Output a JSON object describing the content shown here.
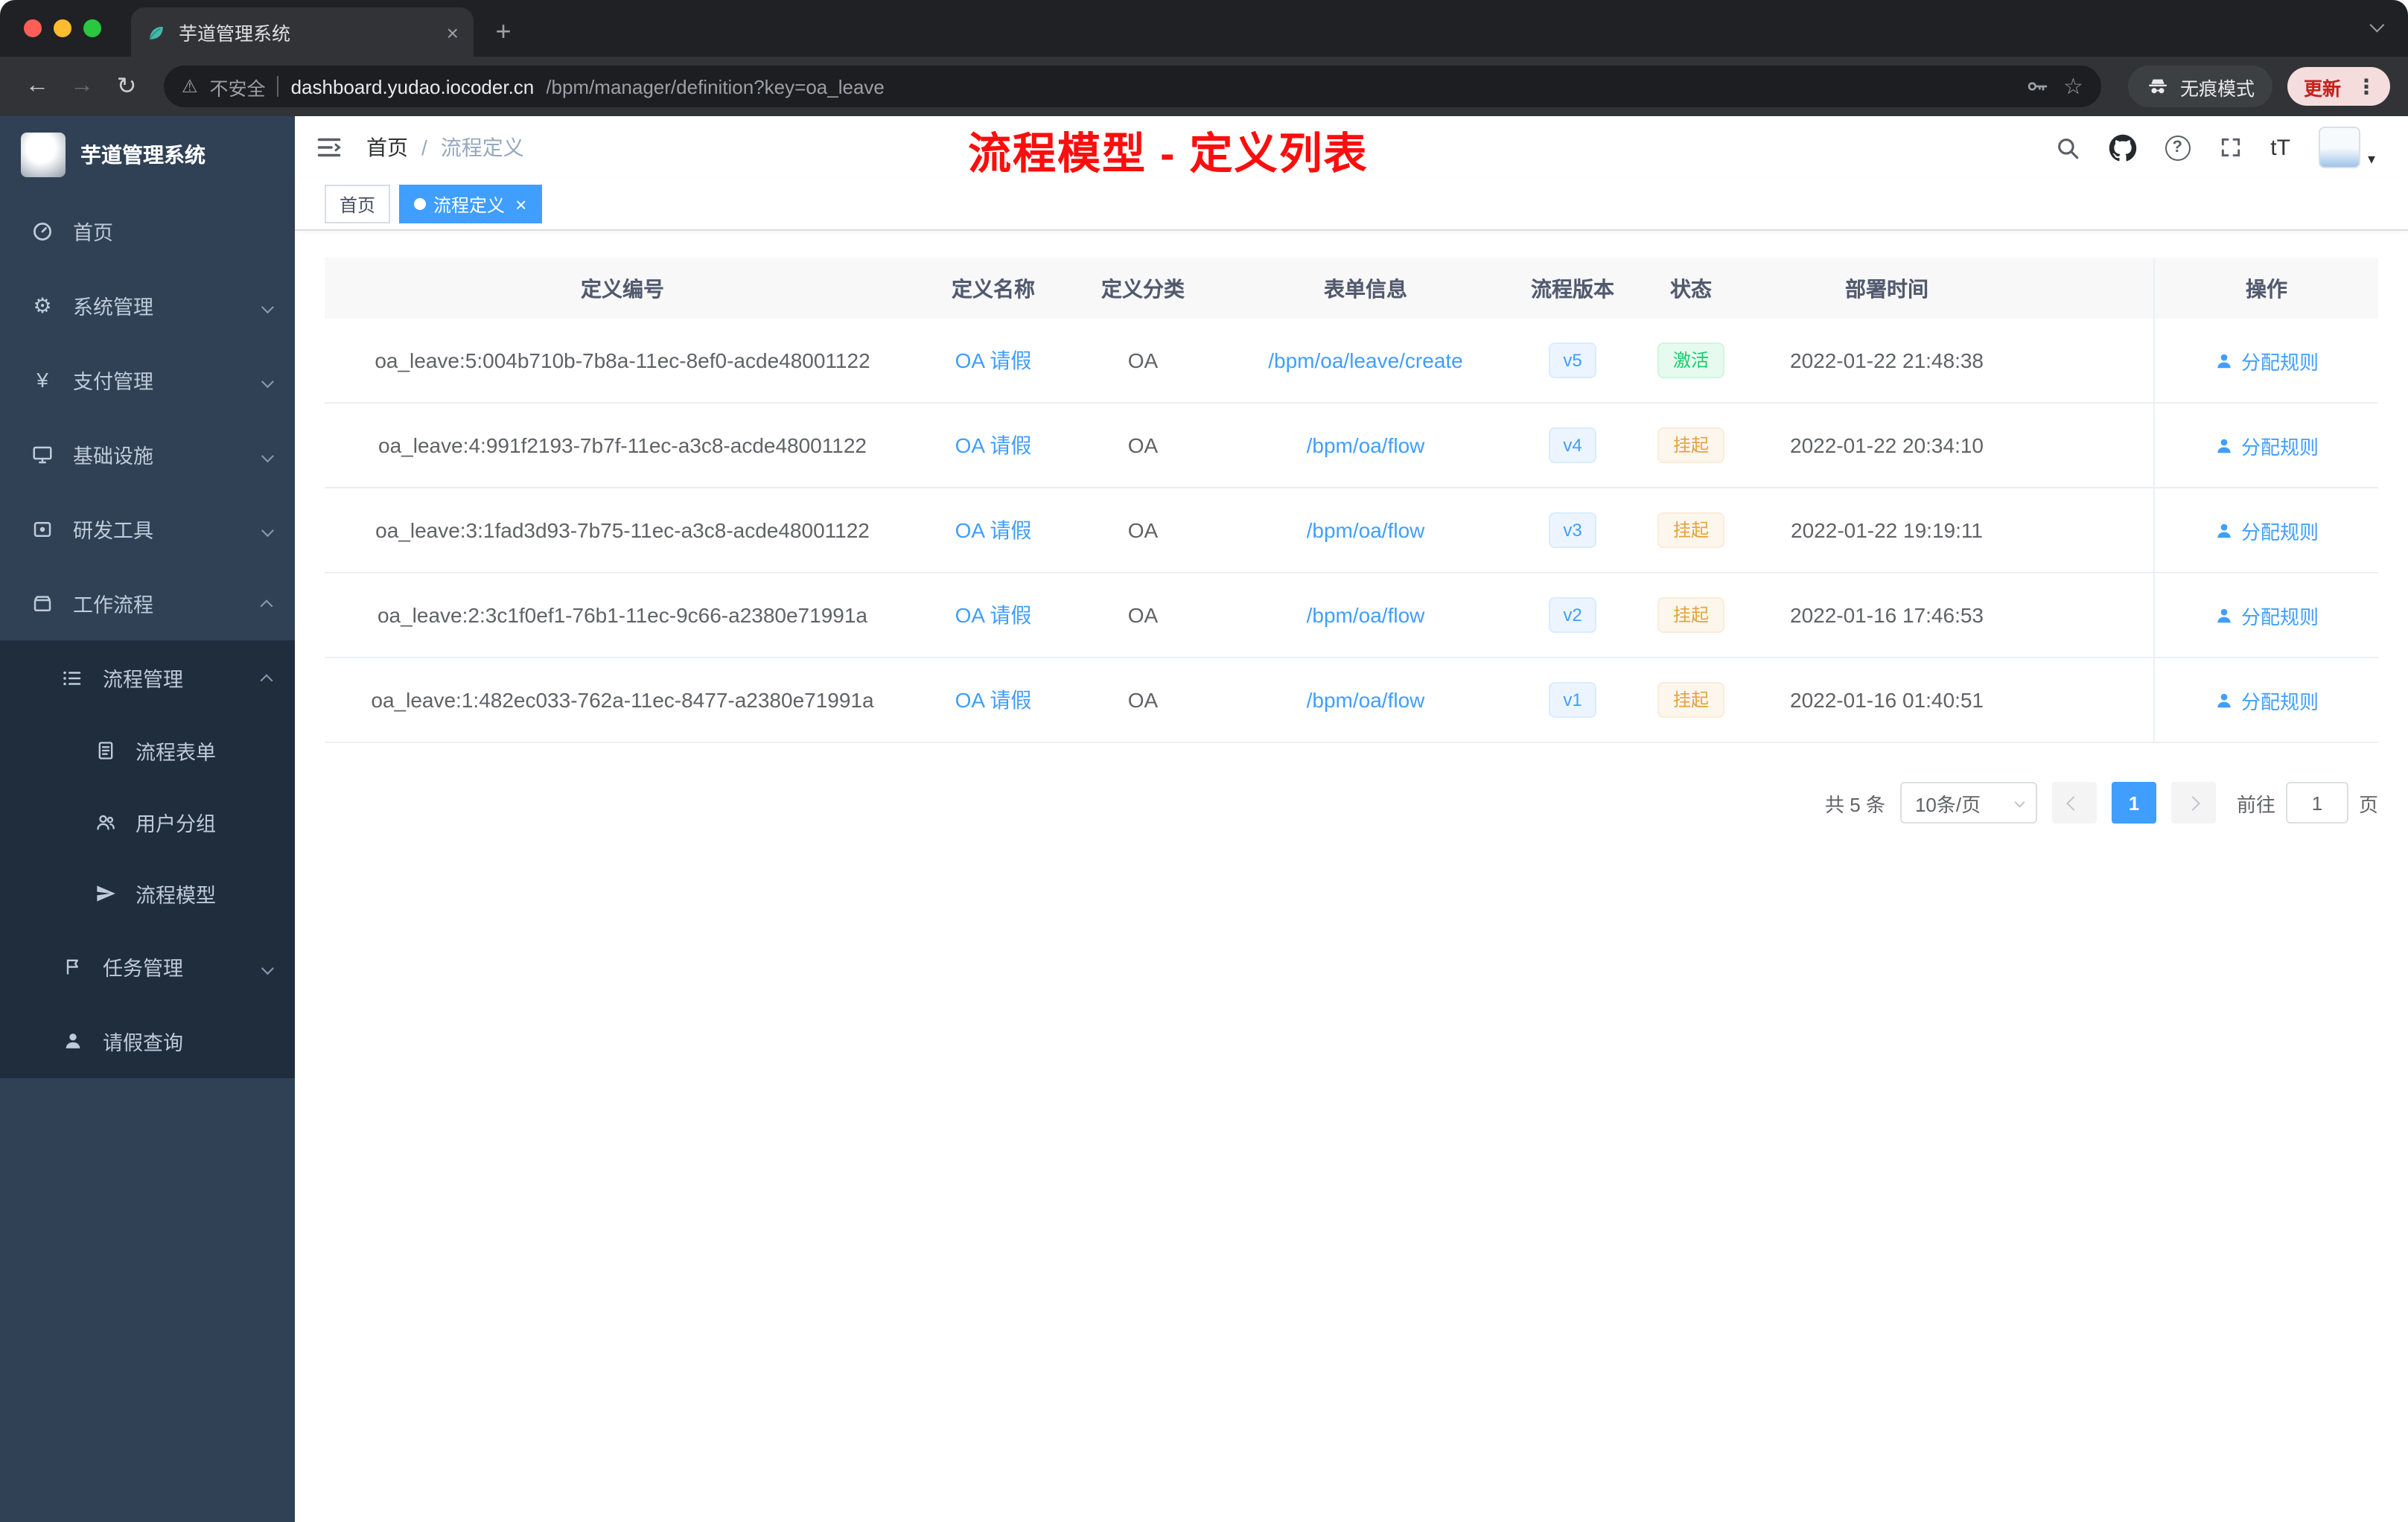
{
  "icons": {
    "back": "←",
    "forward": "→",
    "reload": "↻",
    "star": "☆",
    "more": "⋮",
    "warning": "⚠",
    "close": "×",
    "new_tab": "+",
    "gear": "⚙",
    "yen": "¥",
    "question": "?",
    "font_size": "tT",
    "caret_down": "▾"
  },
  "browser": {
    "tab_title": "芋道管理系统",
    "security_label": "不安全",
    "url_host": "dashboard.yudao.iocoder.cn",
    "url_path": "/bpm/manager/definition?key=oa_leave",
    "incognito_label": "无痕模式",
    "update_label": "更新"
  },
  "sidebar": {
    "logo_title": "芋道管理系统",
    "items": [
      {
        "label": "首页"
      },
      {
        "label": "系统管理"
      },
      {
        "label": "支付管理"
      },
      {
        "label": "基础设施"
      },
      {
        "label": "研发工具"
      },
      {
        "label": "工作流程"
      },
      {
        "label": "流程管理"
      },
      {
        "label": "流程表单"
      },
      {
        "label": "用户分组"
      },
      {
        "label": "流程模型"
      },
      {
        "label": "任务管理"
      },
      {
        "label": "请假查询"
      }
    ]
  },
  "header": {
    "breadcrumb": {
      "home": "首页",
      "separator": "/",
      "current": "流程定义"
    },
    "annotation": "流程模型 - 定义列表"
  },
  "tags": {
    "items": [
      {
        "label": "首页"
      },
      {
        "label": "流程定义"
      }
    ]
  },
  "table": {
    "columns": [
      "定义编号",
      "定义名称",
      "定义分类",
      "表单信息",
      "流程版本",
      "状态",
      "部署时间",
      "操作"
    ],
    "action_label": "分配规则",
    "rows": [
      {
        "id": "oa_leave:5:004b710b-7b8a-11ec-8ef0-acde48001122",
        "name": "OA 请假",
        "category": "OA",
        "form": "/bpm/oa/leave/create",
        "version": "v5",
        "status": "激活",
        "status_type": "success",
        "time": "2022-01-22 21:48:38"
      },
      {
        "id": "oa_leave:4:991f2193-7b7f-11ec-a3c8-acde48001122",
        "name": "OA 请假",
        "category": "OA",
        "form": "/bpm/oa/flow",
        "version": "v4",
        "status": "挂起",
        "status_type": "warning",
        "time": "2022-01-22 20:34:10"
      },
      {
        "id": "oa_leave:3:1fad3d93-7b75-11ec-a3c8-acde48001122",
        "name": "OA 请假",
        "category": "OA",
        "form": "/bpm/oa/flow",
        "version": "v3",
        "status": "挂起",
        "status_type": "warning",
        "time": "2022-01-22 19:19:11"
      },
      {
        "id": "oa_leave:2:3c1f0ef1-76b1-11ec-9c66-a2380e71991a",
        "name": "OA 请假",
        "category": "OA",
        "form": "/bpm/oa/flow",
        "version": "v2",
        "status": "挂起",
        "status_type": "warning",
        "time": "2022-01-16 17:46:53"
      },
      {
        "id": "oa_leave:1:482ec033-762a-11ec-8477-a2380e71991a",
        "name": "OA 请假",
        "category": "OA",
        "form": "/bpm/oa/flow",
        "version": "v1",
        "status": "挂起",
        "status_type": "warning",
        "time": "2022-01-16 01:40:51"
      }
    ]
  },
  "pagination": {
    "total": "共 5 条",
    "page_size": "10条/页",
    "current_page": "1",
    "goto_label": "前往",
    "goto_value": "1",
    "page_unit": "页"
  }
}
